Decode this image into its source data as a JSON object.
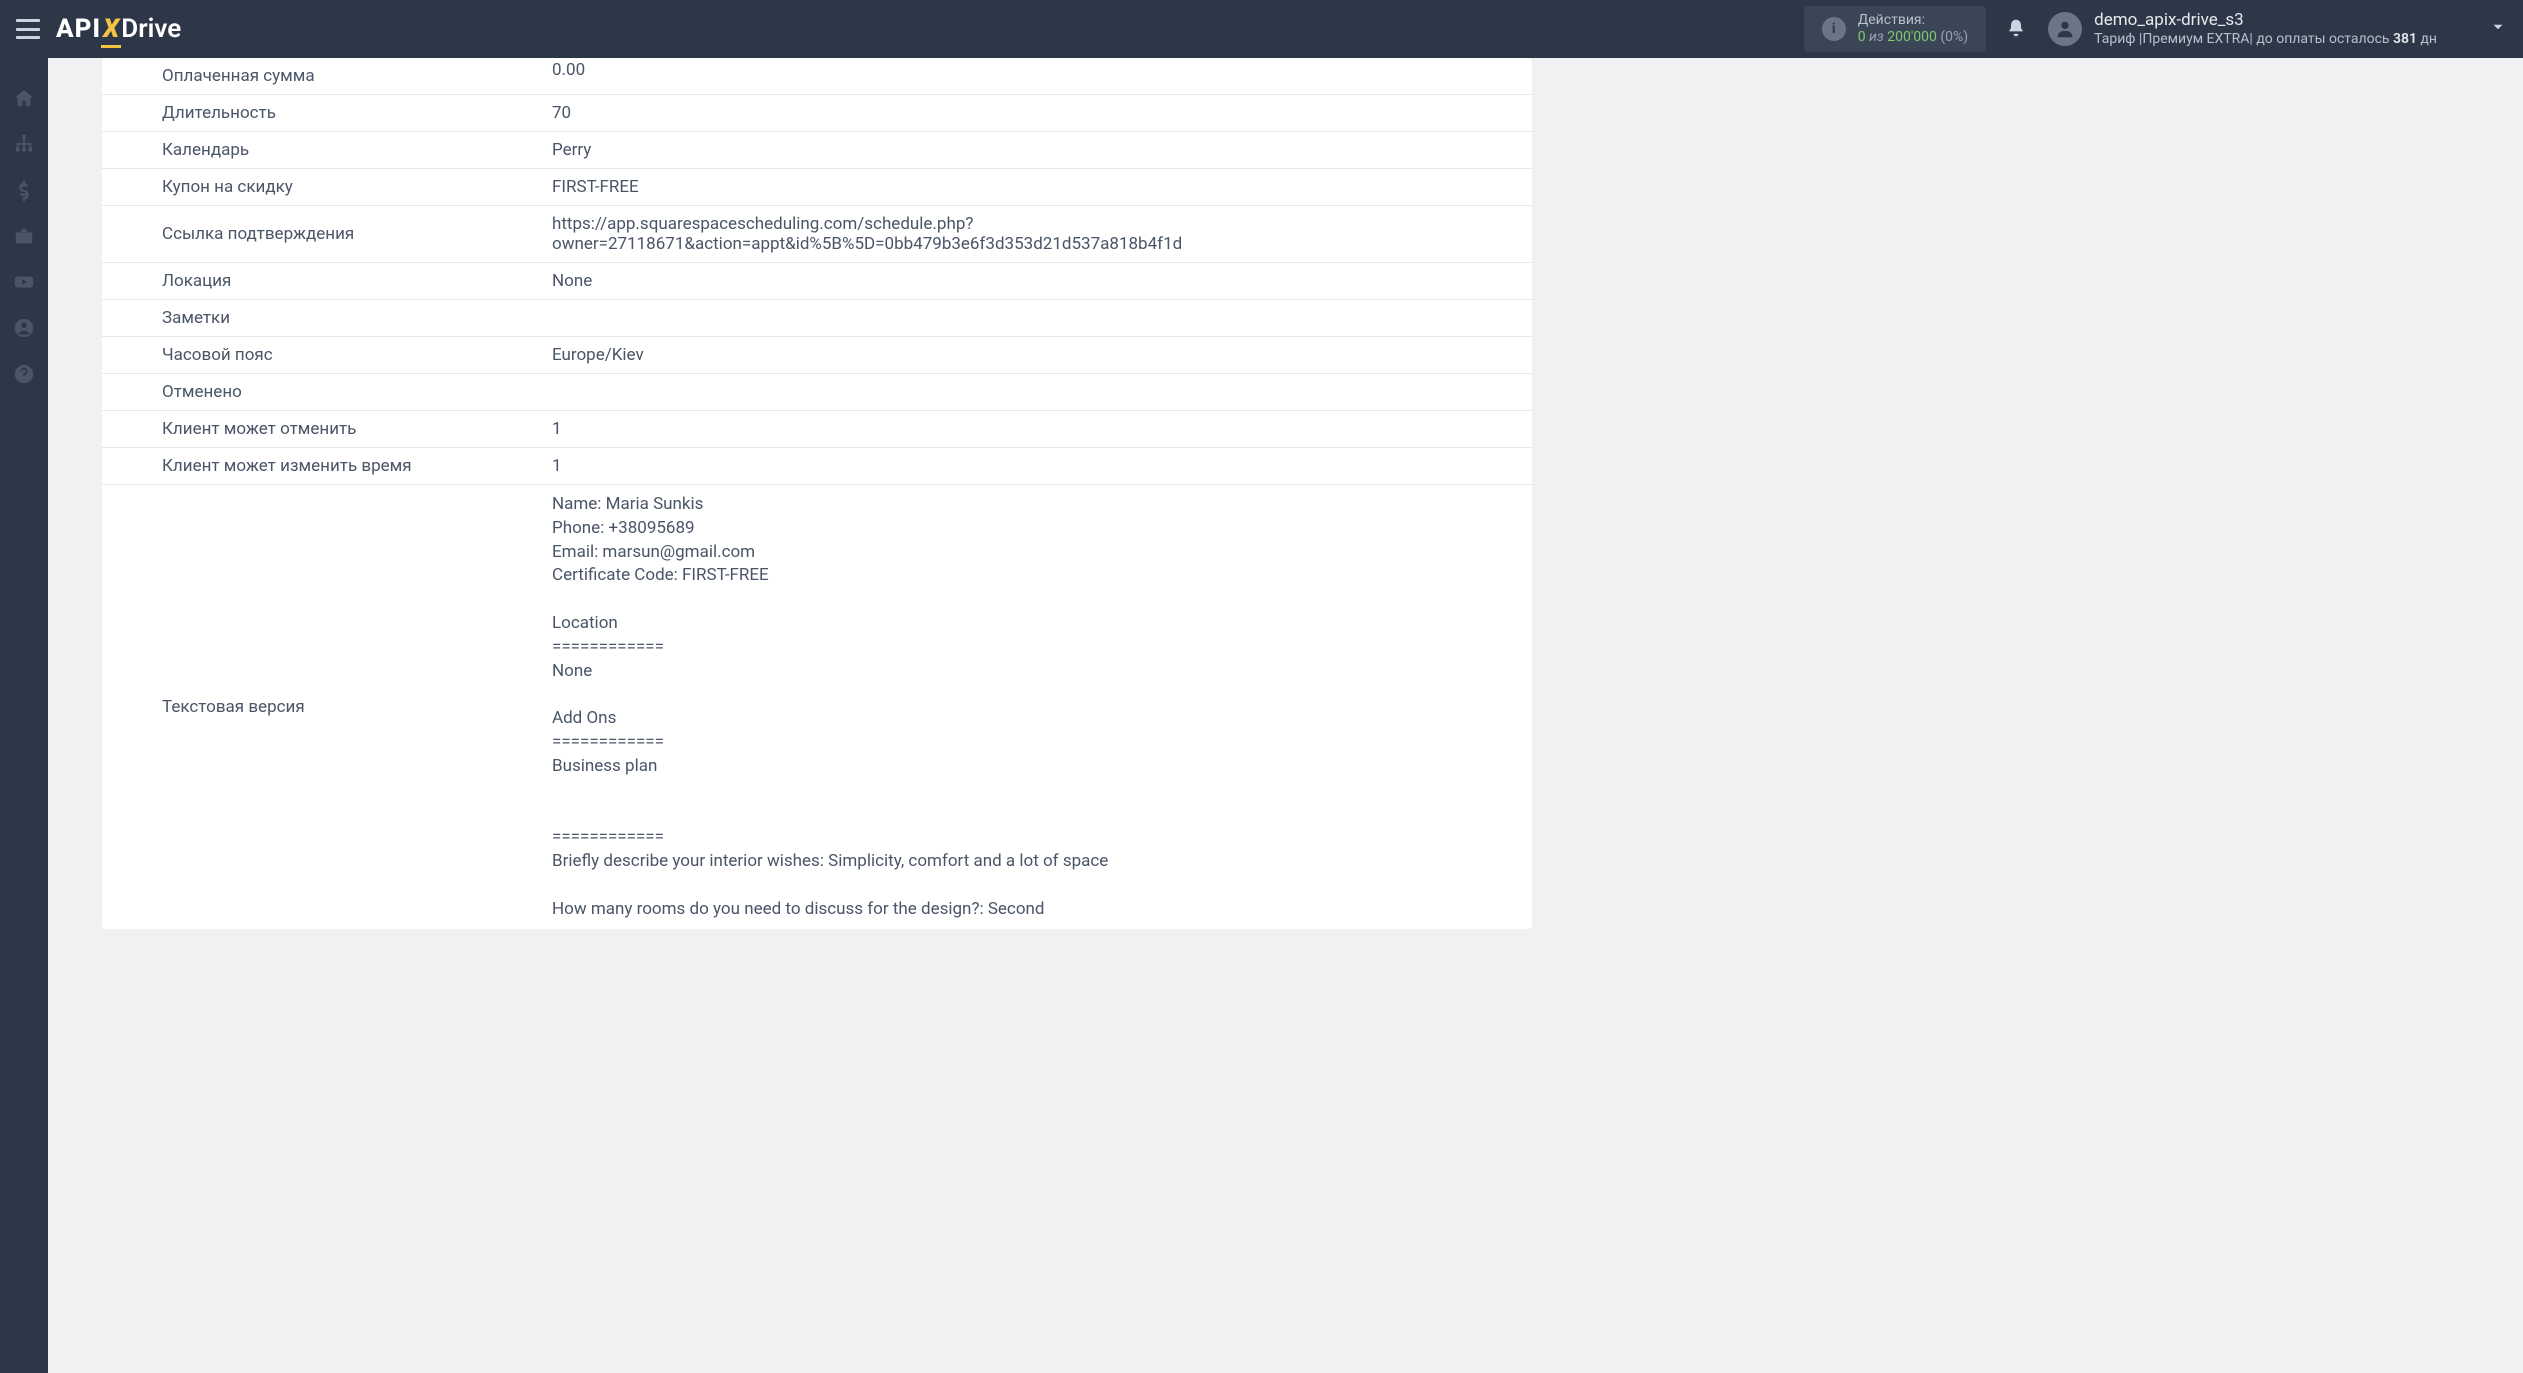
{
  "header": {
    "actions_label": "Действия:",
    "actions_zero": "0",
    "actions_of": " из ",
    "actions_max": "200'000",
    "actions_pct": " (0%)",
    "user_name": "demo_apix-drive_s3",
    "tariff_prefix": "Тариф |",
    "tariff_name": "Премиум EXTRA",
    "tariff_sep": "| до оплаты осталось ",
    "tariff_days": "381",
    "tariff_unit": " дн"
  },
  "rows": [
    {
      "label": "Оплаченная сумма",
      "value": "0.00",
      "cut": true
    },
    {
      "label": "Длительность",
      "value": "70"
    },
    {
      "label": "Календарь",
      "value": "Perry"
    },
    {
      "label": "Купон на скидку",
      "value": "FIRST-FREE"
    },
    {
      "label": "Ссылка подтверждения",
      "value": "https://app.squarespacescheduling.com/schedule.php?owner=27118671&action=appt&id%5B%5D=0bb479b3e6f3d353d21d537a818b4f1d"
    },
    {
      "label": "Локация",
      "value": "None"
    },
    {
      "label": "Заметки",
      "value": ""
    },
    {
      "label": "Часовой пояс",
      "value": "Europe/Kiev"
    },
    {
      "label": "Отменено",
      "value": ""
    },
    {
      "label": "Клиент может отменить",
      "value": "1"
    },
    {
      "label": "Клиент может изменить время",
      "value": "1"
    },
    {
      "label": "Текстовая версия",
      "value": "Name: Maria Sunkis\nPhone: +38095689\nEmail: marsun@gmail.com\nCertificate Code: FIRST-FREE\n\nLocation\n============\nNone\n\nAdd Ons\n============\nBusiness plan\n\n\n============\nBriefly describe your interior wishes: Simplicity, comfort and a lot of space\n\nHow many rooms do you need to discuss for the design?: Second",
      "multiline": true
    }
  ]
}
